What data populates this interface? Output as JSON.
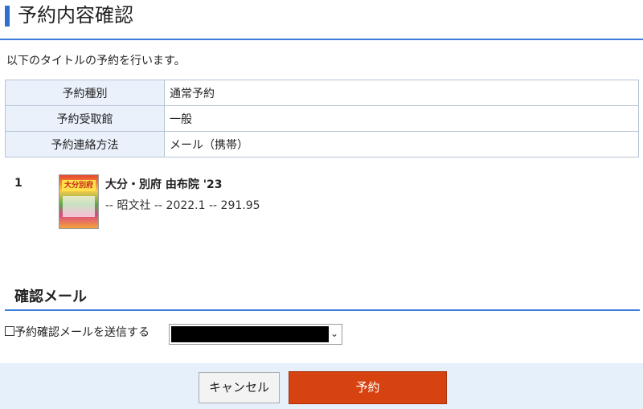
{
  "page": {
    "title": "予約内容確認"
  },
  "intro": {
    "text": "以下のタイトルの予約を行います。"
  },
  "info_table": [
    {
      "label": "予約種別",
      "value": "通常予約"
    },
    {
      "label": "予約受取館",
      "value": "一般"
    },
    {
      "label": "予約連絡方法",
      "value": "メール（携帯）"
    }
  ],
  "item": {
    "number": "1",
    "cover_text": "大分別府",
    "title": "大分・別府 由布院 '23",
    "meta": "-- 昭文社 -- 2022.1 -- 291.95"
  },
  "confirm_mail": {
    "heading": "確認メール",
    "checkbox_label": "予約確認メールを送信する",
    "checkbox_checked": false
  },
  "buttons": {
    "cancel_label": "キャンセル",
    "reserve_label": "予約"
  },
  "colors": {
    "accent": "#3b7dd8",
    "table_label_bg": "#eaf1fb",
    "reserve_button": "#d64310",
    "footer_bg": "#e6f0fb"
  }
}
